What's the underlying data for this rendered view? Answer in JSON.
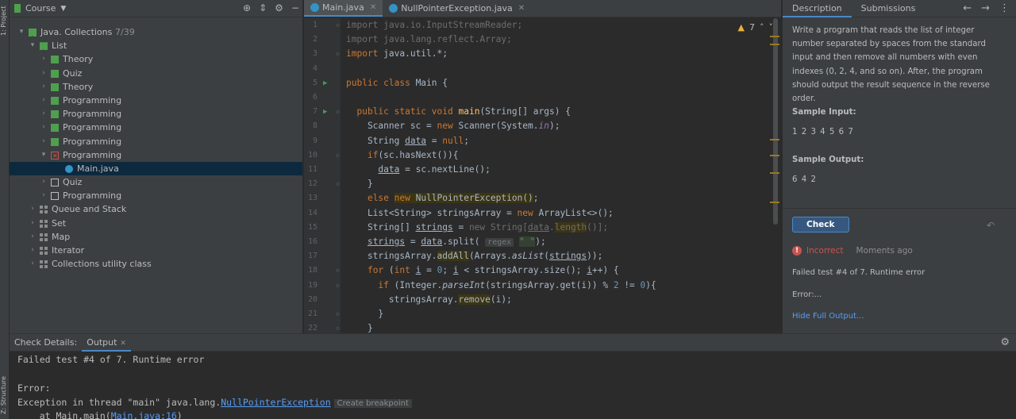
{
  "left_strip": {
    "project_label": "1: Project",
    "structure_label": "Z: Structure"
  },
  "project": {
    "header": "Course",
    "tree": [
      {
        "label": "Java. Collections",
        "count": "7/39",
        "depth": 1,
        "arrow": "▾",
        "icon": "lesson"
      },
      {
        "label": "List",
        "depth": 2,
        "arrow": "▾",
        "icon": "lesson"
      },
      {
        "label": "Theory",
        "depth": 3,
        "arrow": "›",
        "icon": "green"
      },
      {
        "label": "Quiz",
        "depth": 3,
        "arrow": "›",
        "icon": "green"
      },
      {
        "label": "Theory",
        "depth": 3,
        "arrow": "›",
        "icon": "green"
      },
      {
        "label": "Programming",
        "depth": 3,
        "arrow": "›",
        "icon": "green"
      },
      {
        "label": "Programming",
        "depth": 3,
        "arrow": "›",
        "icon": "green"
      },
      {
        "label": "Programming",
        "depth": 3,
        "arrow": "›",
        "icon": "green"
      },
      {
        "label": "Programming",
        "depth": 3,
        "arrow": "›",
        "icon": "green"
      },
      {
        "label": "Programming",
        "depth": 3,
        "arrow": "▾",
        "icon": "red"
      },
      {
        "label": "Main.java",
        "depth": 4,
        "arrow": "",
        "icon": "javafile",
        "selected": true
      },
      {
        "label": "Quiz",
        "depth": 3,
        "arrow": "›",
        "icon": "sq"
      },
      {
        "label": "Programming",
        "depth": 3,
        "arrow": "›",
        "icon": "sq"
      },
      {
        "label": "Queue and Stack",
        "depth": 2,
        "arrow": "›",
        "icon": "grid"
      },
      {
        "label": "Set",
        "depth": 2,
        "arrow": "›",
        "icon": "grid"
      },
      {
        "label": "Map",
        "depth": 2,
        "arrow": "›",
        "icon": "grid"
      },
      {
        "label": "Iterator",
        "depth": 2,
        "arrow": "›",
        "icon": "grid"
      },
      {
        "label": "Collections utility class",
        "depth": 2,
        "arrow": "›",
        "icon": "grid"
      }
    ]
  },
  "editor": {
    "tabs": [
      {
        "label": "Main.java",
        "active": true
      },
      {
        "label": "NullPointerException.java",
        "active": false
      }
    ],
    "warning_count": "7",
    "line_numbers": [
      "1",
      "2",
      "3",
      "4",
      "5",
      "6",
      "7",
      "8",
      "9",
      "10",
      "11",
      "12",
      "13",
      "14",
      "15",
      "16",
      "17",
      "18",
      "19",
      "20",
      "21",
      "22"
    ]
  },
  "description": {
    "tabs": [
      "Description",
      "Submissions"
    ],
    "text": "Write a program that reads the list of integer number separated by spaces from the standard input and then remove all numbers with even indexes (0, 2, 4, and so on). After, the program should output the result sequence in the reverse order.",
    "sample_input_label": "Sample Input:",
    "sample_input": "1 2 3 4 5 6 7",
    "sample_output_label": "Sample Output:",
    "sample_output": "6 4 2",
    "check_button": "Check",
    "status": "Incorrect",
    "status_time": "Moments ago",
    "result_message": "Failed test #4 of 7. Runtime error",
    "error_label": "Error:...",
    "hide_link": "Hide Full Output..."
  },
  "bottom": {
    "tabs": [
      "Check Details:",
      "Output"
    ],
    "output_line1": "Failed test #4 of 7. Runtime error",
    "output_line2": "Error:",
    "output_line3_prefix": "Exception in thread \"main\" java.lang.",
    "output_line3_link": "NullPointerException",
    "create_breakpoint": "Create breakpoint",
    "output_line4_prefix": "    at Main.main(",
    "output_line4_link": "Main.java:16",
    "output_line4_suffix": ")"
  },
  "colors": {
    "accent": "#4a88c7",
    "error": "#c75450",
    "success": "#4f9f4f",
    "keyword": "#cc7832",
    "background": "#2b2b2b"
  }
}
